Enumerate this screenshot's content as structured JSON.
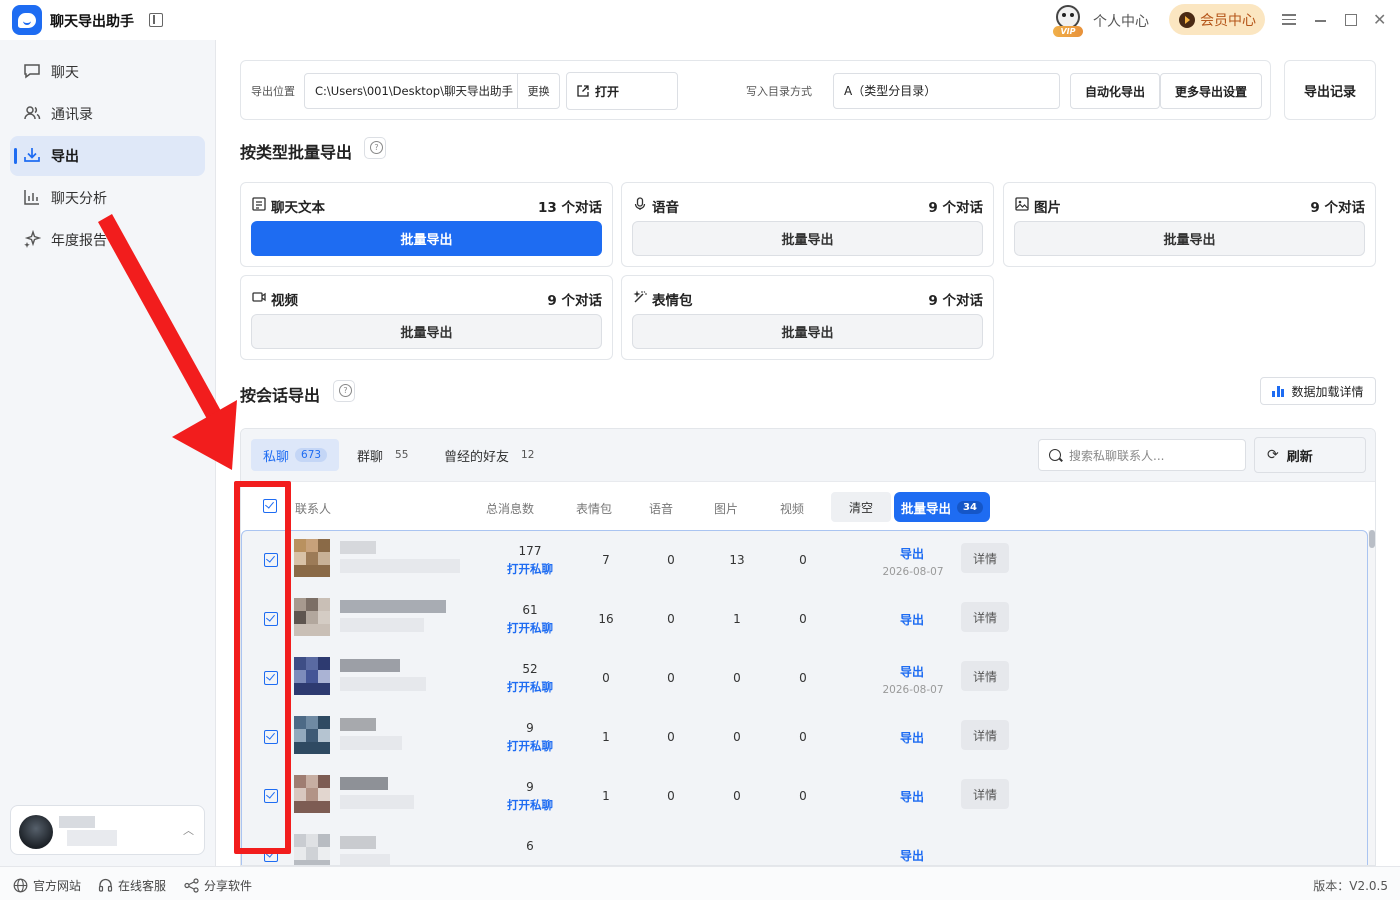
{
  "app": {
    "title": "聊天导出助手"
  },
  "titlebar": {
    "vip_tag": "VIP",
    "personal_center": "个人中心",
    "member_center": "会员中心"
  },
  "sidebar": {
    "items": [
      {
        "label": "聊天",
        "icon": "chat-icon"
      },
      {
        "label": "通讯录",
        "icon": "contacts-icon"
      },
      {
        "label": "导出",
        "icon": "download-icon",
        "active": true
      },
      {
        "label": "聊天分析",
        "icon": "bar-chart-icon"
      },
      {
        "label": "年度报告",
        "icon": "sparkle-icon"
      }
    ]
  },
  "export_settings": {
    "location_label": "导出位置",
    "path": "C:\\Users\\001\\Desktop\\聊天导出助手",
    "change_label": "更换",
    "open_label": "打开",
    "dir_mode_label": "写入目录方式",
    "dir_mode_value": "A（类型分目录）",
    "auto_export_label": "自动化导出",
    "more_settings_label": "更多导出设置",
    "export_record_label": "导出记录"
  },
  "by_type": {
    "title": "按类型批量导出",
    "cards": [
      {
        "name": "聊天文本",
        "icon": "text-doc-icon",
        "count": "13 个对话",
        "button": "批量导出",
        "primary": true
      },
      {
        "name": "语音",
        "icon": "microphone-icon",
        "count": "9 个对话",
        "button": "批量导出"
      },
      {
        "name": "图片",
        "icon": "image-icon",
        "count": "9 个对话",
        "button": "批量导出"
      },
      {
        "name": "视频",
        "icon": "video-icon",
        "count": "9 个对话",
        "button": "批量导出"
      },
      {
        "name": "表情包",
        "icon": "magic-wand-icon",
        "count": "9 个对话",
        "button": "批量导出"
      }
    ]
  },
  "by_session": {
    "title": "按会话导出",
    "load_detail_label": "数据加载详情",
    "tabs": [
      {
        "label": "私聊",
        "count": "673",
        "active": true
      },
      {
        "label": "群聊",
        "count": "55"
      },
      {
        "label": "曾经的好友",
        "count": "12"
      }
    ],
    "search_placeholder": "搜索私聊联系人...",
    "refresh_label": "刷新",
    "columns": [
      "联系人",
      "总消息数",
      "表情包",
      "语音",
      "图片",
      "视频"
    ],
    "clear_label": "清空",
    "batch_export_label": "批量导出",
    "batch_count": "34",
    "rows": [
      {
        "total": "177",
        "open": "打开私聊",
        "emoji": "7",
        "voice": "0",
        "image": "13",
        "video": "0",
        "export": "导出",
        "date": "2026-08-07",
        "detail": "详情"
      },
      {
        "total": "61",
        "open": "打开私聊",
        "emoji": "16",
        "voice": "0",
        "image": "1",
        "video": "0",
        "export": "导出",
        "date": "",
        "detail": "详情"
      },
      {
        "total": "52",
        "open": "打开私聊",
        "emoji": "0",
        "voice": "0",
        "image": "0",
        "video": "0",
        "export": "导出",
        "date": "2026-08-07",
        "detail": "详情"
      },
      {
        "total": "9",
        "open": "打开私聊",
        "emoji": "1",
        "voice": "0",
        "image": "0",
        "video": "0",
        "export": "导出",
        "date": "",
        "detail": "详情"
      },
      {
        "total": "9",
        "open": "打开私聊",
        "emoji": "1",
        "voice": "0",
        "image": "0",
        "video": "0",
        "export": "导出",
        "date": "",
        "detail": "详情"
      },
      {
        "total": "6",
        "open": "",
        "emoji": "",
        "voice": "",
        "image": "",
        "video": "",
        "export": "导出",
        "date": "",
        "detail": ""
      }
    ]
  },
  "bottombar": {
    "website": "官方网站",
    "support": "在线客服",
    "share": "分享软件",
    "version": "版本：V2.0.5"
  },
  "colors": {
    "accent": "#1e6cf2",
    "annotation": "#f21d1d"
  }
}
